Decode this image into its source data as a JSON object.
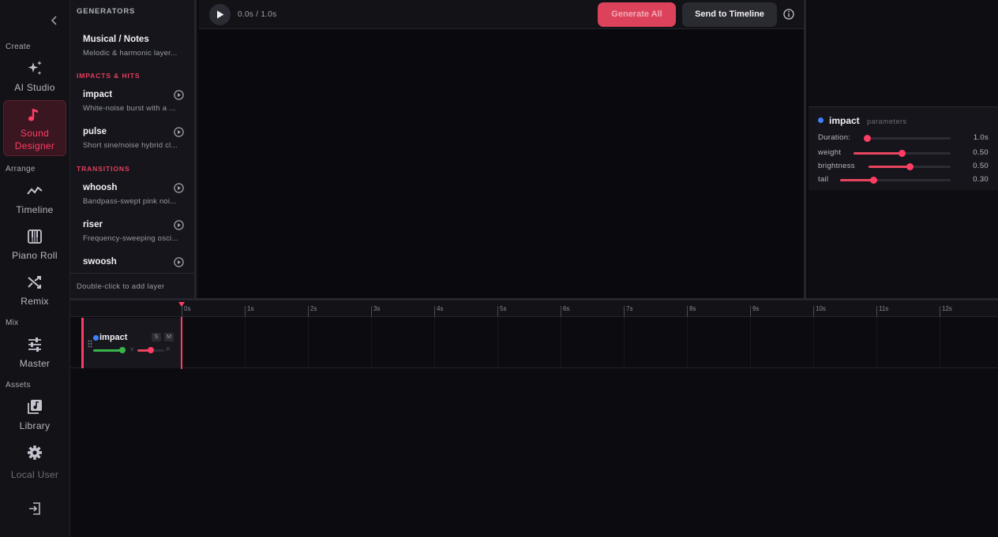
{
  "nav": {
    "sections": {
      "create": "Create",
      "arrange": "Arrange",
      "mix": "Mix",
      "assets": "Assets"
    },
    "items": {
      "ai_studio": "AI Studio",
      "sound_designer_1": "Sound",
      "sound_designer_2": "Designer",
      "timeline": "Timeline",
      "piano_roll": "Piano Roll",
      "remix": "Remix",
      "master": "Master",
      "library": "Library",
      "local_user": "Local User"
    },
    "accent": "#ff3d64"
  },
  "generators": {
    "heading": "GENERATORS",
    "musical": {
      "title": "Musical / Notes",
      "desc": "Melodic & harmonic layer..."
    },
    "impacts_heading": "IMPACTS & HITS",
    "impact": {
      "title": "impact",
      "desc": "White-noise burst with a ..."
    },
    "pulse": {
      "title": "pulse",
      "desc": "Short sine/noise hybrid cl..."
    },
    "transitions_heading": "TRANSITIONS",
    "whoosh": {
      "title": "whoosh",
      "desc": "Bandpass-swept pink noi..."
    },
    "riser": {
      "title": "riser",
      "desc": "Frequency-sweeping osci..."
    },
    "swoosh": {
      "title": "swoosh"
    },
    "footer": "Double-click to add layer"
  },
  "toolbar": {
    "time": "0.0s / 1.0s",
    "generate_all": "Generate All",
    "send_to_timeline": "Send to Timeline"
  },
  "params": {
    "title": "impact",
    "subtitle": "parameters",
    "dot_color": "#3b82f6",
    "rows": [
      {
        "label": "Duration:",
        "value": "1.0s",
        "level": 0.0
      },
      {
        "label": "weight",
        "value": "0.50",
        "level": 0.5
      },
      {
        "label": "brightness",
        "value": "0.50",
        "level": 0.5
      },
      {
        "label": "tail",
        "value": "0.30",
        "level": 0.3
      }
    ]
  },
  "timeline": {
    "ticks": [
      "0s",
      "1s",
      "2s",
      "3s",
      "4s",
      "5s",
      "6s",
      "7s",
      "8s",
      "9s",
      "10s",
      "11s",
      "12s"
    ],
    "track": {
      "name": "impact",
      "solo": "S",
      "mute": "M",
      "vol_label": "V",
      "pan_label": "P",
      "volume": 0.85,
      "pan": 0.5
    }
  }
}
